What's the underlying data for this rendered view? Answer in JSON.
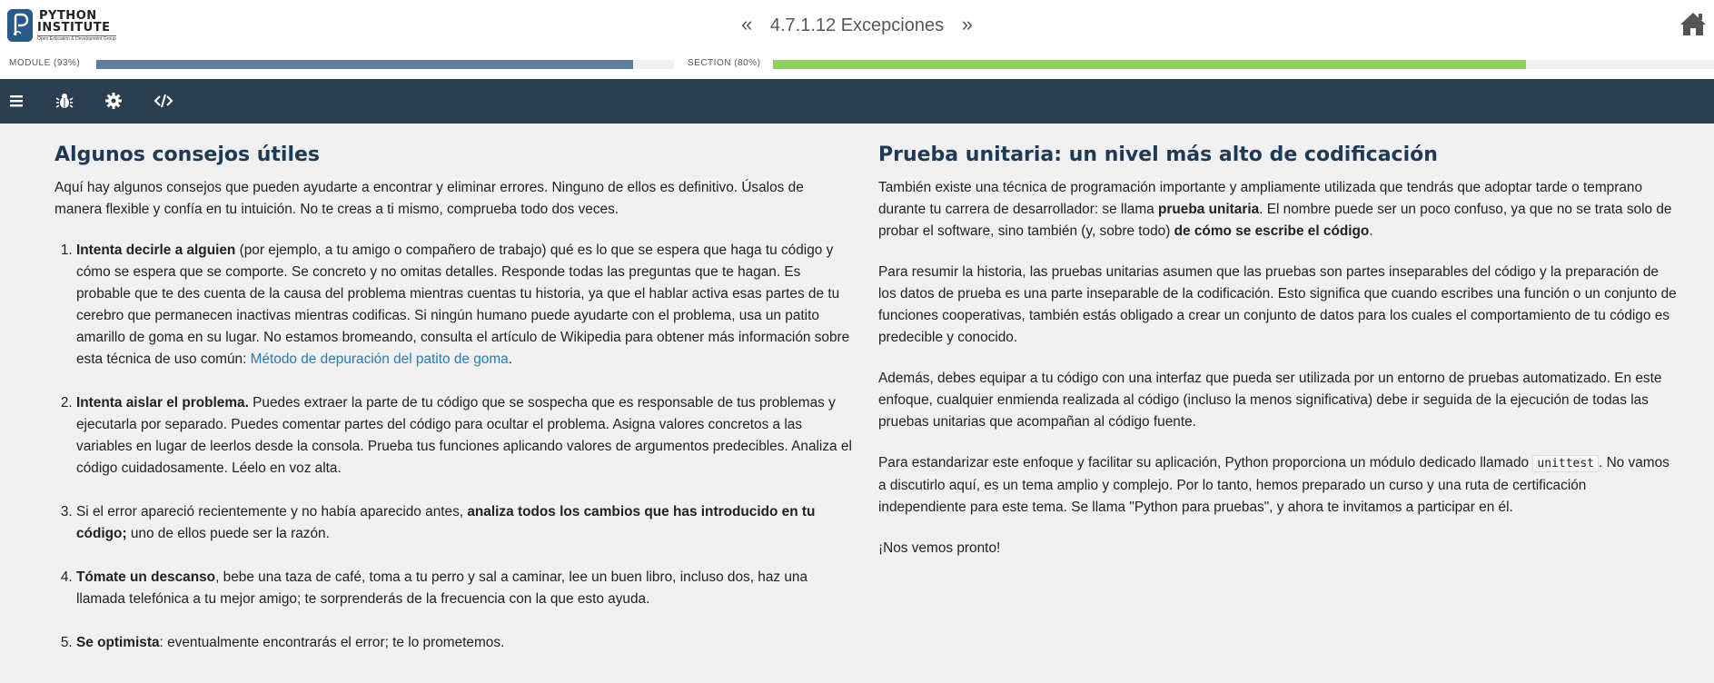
{
  "header": {
    "logo_line1": "PYTHON",
    "logo_line2": "INSTITUTE",
    "logo_sub": "Open Education & Development Group",
    "prev_glyph": "«",
    "next_glyph": "»",
    "title": "4.7.1.12 Excepciones",
    "home_icon": "home-icon"
  },
  "progress": {
    "module_label": "MODULE (93%)",
    "module_value": 0.93,
    "module_color": "#5f7d9c",
    "section_label": "SECTION (80%)",
    "section_value": 0.8,
    "section_color": "#8fce5f"
  },
  "toolbar": {
    "background": "#2b3e50",
    "icons": [
      "menu-icon",
      "bug-icon",
      "gear-icon",
      "code-icon"
    ]
  },
  "left": {
    "heading": "Algunos consejos útiles",
    "intro": "Aquí hay algunos consejos que pueden ayudarte a encontrar y eliminar errores. Ninguno de ellos es definitivo. Úsalos de manera flexible y confía en tu intuición. No te creas a ti mismo, comprueba todo dos veces.",
    "items": [
      {
        "bold": "Intenta decirle a alguien",
        "text": " (por ejemplo, a tu amigo o compañero de trabajo) qué es lo que se espera que haga tu código y cómo se espera que se comporte. Se concreto y no omitas detalles. Responde todas las preguntas que te hagan. Es probable que te des cuenta de la causa del problema mientras cuentas tu historia, ya que el hablar activa esas partes de tu cerebro que permanecen inactivas mientras codificas. Si ningún humano puede ayudarte con el problema, usa un patito amarillo de goma en su lugar. No estamos bromeando, consulta el artículo de Wikipedia para obtener más información sobre esta técnica de uso común: ",
        "link": "Método de depuración del patito de goma",
        "tail": "."
      },
      {
        "bold": "Intenta aislar el problema.",
        "text": " Puedes extraer la parte de tu código que se sospecha que es responsable de tus problemas y ejecutarla por separado. Puedes comentar partes del código para ocultar el problema. Asigna valores concretos a las variables en lugar de leerlos desde la consola. Prueba tus funciones aplicando valores de argumentos predecibles. Analiza el código cuidadosamente. Léelo en voz alta."
      },
      {
        "pre": "Si el error apareció recientemente y no había aparecido antes, ",
        "bold": "analiza todos los cambios que has introducido en tu código;",
        "text": " uno de ellos puede ser la razón."
      },
      {
        "bold": "Tómate un descanso",
        "text": ", bebe una taza de café, toma a tu perro y sal a caminar, lee un buen libro, incluso dos, haz una llamada telefónica a tu mejor amigo; te sorprenderás de la frecuencia con la que esto ayuda."
      },
      {
        "bold": "Se optimista",
        "text": ": eventualmente encontrarás el error; te lo prometemos."
      }
    ]
  },
  "right": {
    "heading": "Prueba unitaria: un nivel más alto de codificación",
    "p1_a": "También existe una técnica de programación importante y ampliamente utilizada que tendrás que adoptar tarde o temprano durante tu carrera de desarrollador: se llama ",
    "p1_b": "prueba unitaria",
    "p1_c": ". El nombre puede ser un poco confuso, ya que no se trata solo de probar el software, sino también (y, sobre todo) ",
    "p1_d": "de cómo se escribe el código",
    "p1_e": ".",
    "p2": "Para resumir la historia, las pruebas unitarias asumen que las pruebas son partes inseparables del código y la preparación de los datos de prueba es una parte inseparable de la codificación. Esto significa que cuando escribes una función o un conjunto de funciones cooperativas, también estás obligado a crear un conjunto de datos para los cuales el comportamiento de tu código es predecible y conocido.",
    "p3": "Además, debes equipar a tu código con una interfaz que pueda ser utilizada por un entorno de pruebas automatizado. En este enfoque, cualquier enmienda realizada al código (incluso la menos significativa) debe ir seguida de la ejecución de todas las pruebas unitarias que acompañan al código fuente.",
    "p4_a": "Para estandarizar este enfoque y facilitar su aplicación, Python proporciona un módulo dedicado llamado ",
    "p4_code": "unittest",
    "p4_b": ". No vamos a discutirlo aquí, es un tema amplio y complejo. Por lo tanto, hemos preparado un curso y una ruta de certificación independiente para este tema. Se llama \"Python para pruebas\", y ahora te invitamos a participar en él.",
    "p5": "¡Nos vemos pronto!"
  }
}
